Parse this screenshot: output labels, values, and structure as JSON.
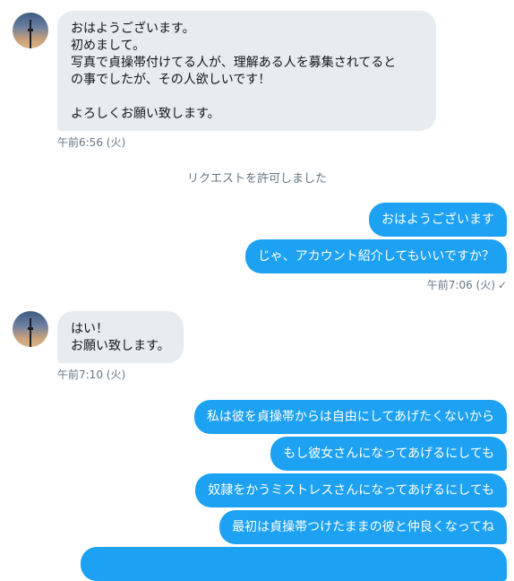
{
  "conversation": {
    "group1": {
      "message": "おはようございます。\n初めまして。\n写真で貞操帯付けてる人が、理解ある人を募集されてると\nの事でしたが、その人欲しいです！\n\nよろしくお願い致します。",
      "time": "午前6:56 (火)"
    },
    "system_notice": "リクエストを許可しました",
    "group2": {
      "messages": [
        "おはようございます",
        "じゃ、アカウント紹介してもいいですか？"
      ],
      "time": "午前7:06 (火)",
      "status_icon": "✓"
    },
    "group3": {
      "message": "はい！\nお願い致します。",
      "time": "午前7:10 (火)"
    },
    "group4": {
      "messages": [
        "私は彼を貞操帯からは自由にしてあげたくないから",
        "もし彼女さんになってあげるにしても",
        "奴隷をかうミストレスさんになってあげるにしても",
        "最初は貞操帯つけたままの彼と仲良くなってね"
      ]
    }
  },
  "colors": {
    "incoming_bubble": "#e6ecf0",
    "outgoing_bubble": "#1da1f2",
    "meta_text": "#657786"
  }
}
